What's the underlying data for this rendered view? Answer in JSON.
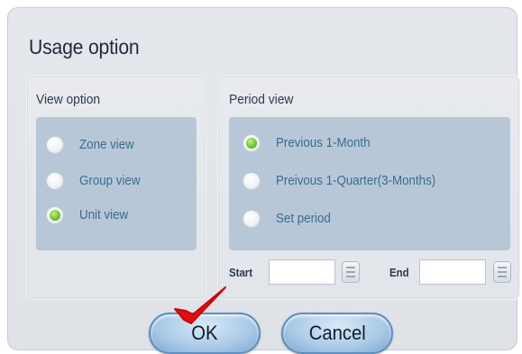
{
  "dialog": {
    "title": "Usage option"
  },
  "view_option": {
    "title": "View option",
    "items": [
      {
        "label": "Zone view",
        "selected": false
      },
      {
        "label": "Group view",
        "selected": false
      },
      {
        "label": "Unit view",
        "selected": true
      }
    ]
  },
  "period_view": {
    "title": "Period view",
    "items": [
      {
        "label": "Previous 1-Month",
        "selected": true
      },
      {
        "label": "Preivous 1-Quarter(3-Months)",
        "selected": false
      },
      {
        "label": "Set period",
        "selected": false
      }
    ],
    "start_label": "Start",
    "start_value": "",
    "end_label": "End",
    "end_value": ""
  },
  "buttons": {
    "ok": "OK",
    "cancel": "Cancel"
  },
  "colors": {
    "accent_blue": "#a9c9e6",
    "option_panel": "#b8c7d8",
    "radio_selected": "#6fbe2e",
    "check_mark": "#e01010",
    "label_text": "#3a6c8f"
  },
  "icons": [
    "calendar-icon",
    "checkmark-icon"
  ]
}
